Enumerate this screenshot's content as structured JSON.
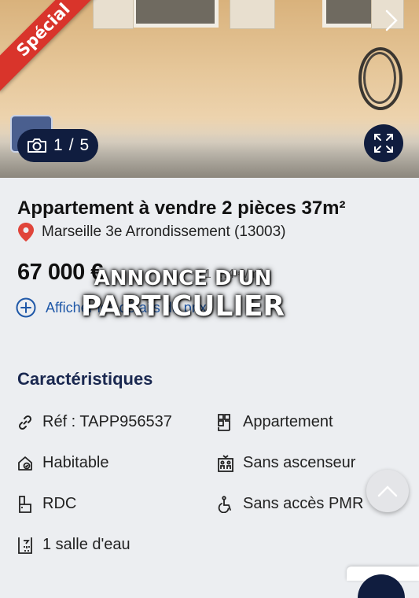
{
  "photo": {
    "badge": "Spécial",
    "counter": {
      "current": "1",
      "separator": "/",
      "total": "5"
    }
  },
  "listing": {
    "title": "Appartement à vendre 2 pièces 37m²",
    "location": "Marseille 3e Arrondissement (13003)",
    "price": "67 000 €",
    "price_extra": "1 …4 €/m²",
    "details_link": "Afficher les détails du prix"
  },
  "overlay": {
    "line1": "ANNONCE D'UN",
    "line2": "PARTICULIER"
  },
  "characteristics": {
    "heading": "Caractéristiques",
    "items": [
      {
        "icon": "link-icon",
        "label": "Réf : TAPP956537"
      },
      {
        "icon": "building-grid-icon",
        "label": "Appartement"
      },
      {
        "icon": "house-check-icon",
        "label": "Habitable"
      },
      {
        "icon": "elevator-icon",
        "label": "Sans ascenseur"
      },
      {
        "icon": "floor-level-icon",
        "label": "RDC"
      },
      {
        "icon": "wheelchair-icon",
        "label": "Sans accès PMR"
      },
      {
        "icon": "shower-icon",
        "label": "1 salle d'eau"
      }
    ]
  },
  "colors": {
    "accent_red": "#d9342b",
    "navy": "#101d3f",
    "link_blue": "#1f58a8"
  }
}
